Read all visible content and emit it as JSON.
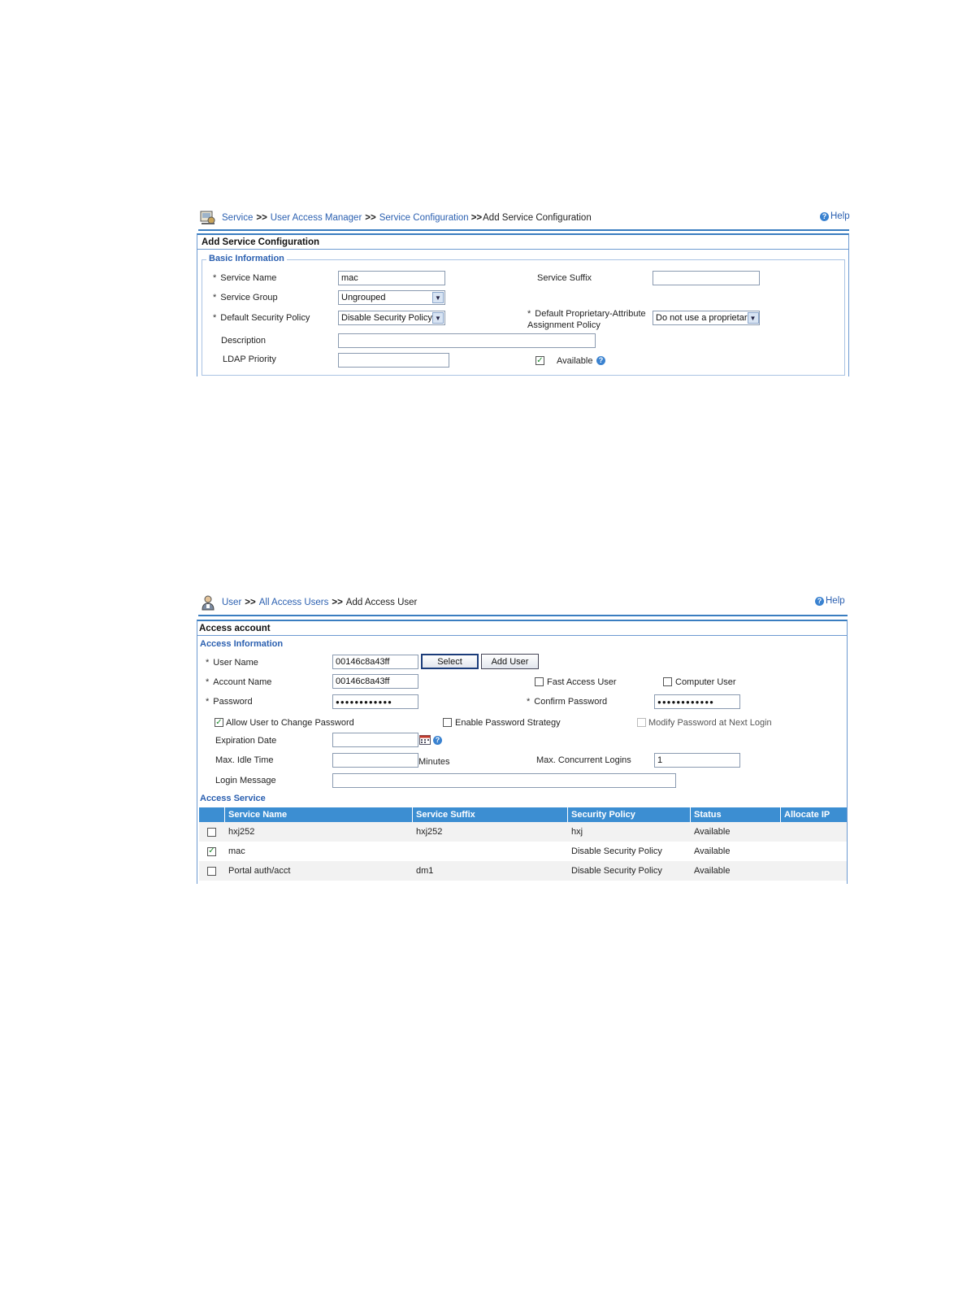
{
  "panel1": {
    "breadcrumb": [
      "Service",
      "User Access Manager",
      "Service Configuration",
      "Add Service Configuration"
    ],
    "separator": ">>",
    "help": "Help",
    "title": "Add Service Configuration",
    "legend": "Basic Information",
    "service_name": {
      "label": "Service Name",
      "value": "mac"
    },
    "service_suffix": {
      "label": "Service Suffix",
      "value": ""
    },
    "service_group": {
      "label": "Service Group",
      "value": "Ungrouped"
    },
    "default_security_policy": {
      "label": "Default Security Policy",
      "value": "Disable Security Policy"
    },
    "default_proprietary": {
      "label_line1": "Default Proprietary-Attribute",
      "label_line2": "Assignment Policy",
      "value": "Do not use a proprietar"
    },
    "description": {
      "label": "Description",
      "value": ""
    },
    "ldap_priority": {
      "label": "LDAP Priority",
      "value": ""
    },
    "available": {
      "label": "Available",
      "checked": true
    },
    "required_mark": "*"
  },
  "panel2": {
    "breadcrumb": [
      "User",
      "All Access Users",
      "Add Access User"
    ],
    "separator": ">>",
    "help": "Help",
    "title": "Access account",
    "access_info_legend": "Access Information",
    "user_name": {
      "label": "User Name",
      "value": "00146c8a43ff"
    },
    "select_button": "Select",
    "add_user_button": "Add User",
    "account_name": {
      "label": "Account Name",
      "value": "00146c8a43ff"
    },
    "fast_access_user": {
      "label": "Fast Access User",
      "checked": false
    },
    "computer_user": {
      "label": "Computer User",
      "checked": false
    },
    "password": {
      "label": "Password",
      "value": "●●●●●●●●●●●●"
    },
    "confirm_password": {
      "label": "Confirm Password",
      "value": "●●●●●●●●●●●●"
    },
    "allow_change_password": {
      "label": "Allow User to Change Password",
      "checked": true
    },
    "enable_password_strategy": {
      "label": "Enable Password Strategy",
      "checked": false
    },
    "modify_password_next_login": {
      "label": "Modify Password at Next Login",
      "checked": false,
      "disabled": true
    },
    "expiration_date": {
      "label": "Expiration Date",
      "value": ""
    },
    "max_idle_time": {
      "label": "Max. Idle Time",
      "value": "",
      "unit": "Minutes"
    },
    "max_concurrent_logins": {
      "label": "Max. Concurrent Logins",
      "value": "1"
    },
    "login_message": {
      "label": "Login Message",
      "value": ""
    },
    "access_service_legend": "Access Service",
    "required_mark": "*",
    "table": {
      "columns": [
        "Service Name",
        "Service Suffix",
        "Security Policy",
        "Status",
        "Allocate IP"
      ],
      "rows": [
        {
          "checked": false,
          "service_name": "hxj252",
          "service_suffix": "hxj252",
          "security_policy": "hxj",
          "status": "Available",
          "allocate_ip": ""
        },
        {
          "checked": true,
          "service_name": "mac",
          "service_suffix": "",
          "security_policy": "Disable Security Policy",
          "status": "Available",
          "allocate_ip": ""
        },
        {
          "checked": false,
          "service_name": "Portal auth/acct",
          "service_suffix": "dm1",
          "security_policy": "Disable Security Policy",
          "status": "Available",
          "allocate_ip": ""
        }
      ]
    }
  }
}
